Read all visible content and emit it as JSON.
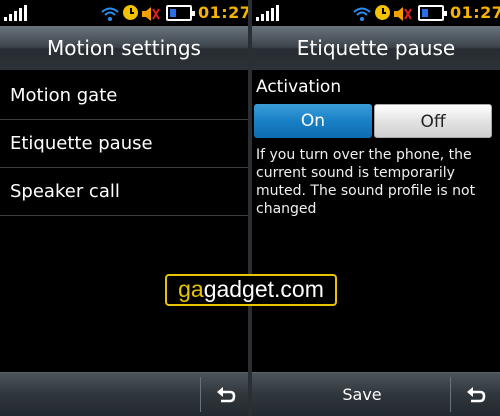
{
  "status": {
    "time": "01:27"
  },
  "left_screen": {
    "title": "Motion settings",
    "items": [
      {
        "label": "Motion gate"
      },
      {
        "label": "Etiquette pause"
      },
      {
        "label": "Speaker call"
      }
    ]
  },
  "right_screen": {
    "title": "Etiquette pause",
    "section_label": "Activation",
    "toggle": {
      "on_label": "On",
      "off_label": "Off",
      "selected": "On"
    },
    "description": "If you turn over the phone, the current sound is temporarily muted. The sound profile is not changed",
    "save_label": "Save"
  },
  "icons": {
    "signal": "signal-icon",
    "wifi": "wifi-icon",
    "alarm": "alarm-clock-icon",
    "mute": "mute-icon",
    "battery": "battery-icon",
    "back": "back-icon"
  },
  "colors": {
    "accent": "#1980c5",
    "time": "#f5b400",
    "watermark_border": "#e8c400"
  },
  "watermark": {
    "part_a": "ga",
    "part_b": "gadget.com"
  }
}
